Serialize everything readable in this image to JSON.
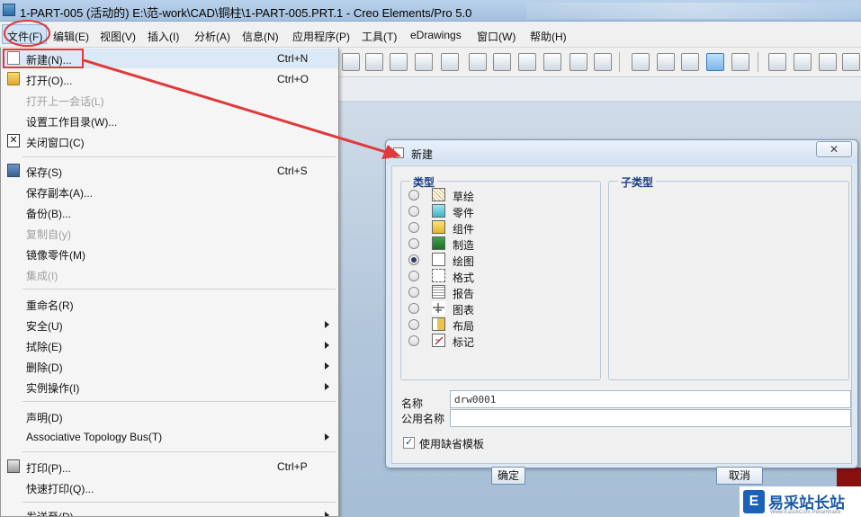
{
  "window": {
    "title": "1-PART-005 (活动的) E:\\范-work\\CAD\\铜柱\\1-PART-005.PRT.1 - Creo Elements/Pro 5.0"
  },
  "menubar": {
    "items": [
      "文件(F)",
      "编辑(E)",
      "视图(V)",
      "插入(I)",
      "分析(A)",
      "信息(N)",
      "应用程序(P)",
      "工具(T)",
      "eDrawings",
      "窗口(W)",
      "帮助(H)"
    ]
  },
  "file_menu": {
    "new": {
      "label": "新建(N)...",
      "shortcut": "Ctrl+N"
    },
    "open": {
      "label": "打开(O)...",
      "shortcut": "Ctrl+O"
    },
    "open_last_session": {
      "label": "打开上一会话(L)"
    },
    "set_working_dir": {
      "label": "设置工作目录(W)..."
    },
    "close_window": {
      "label": "关闭窗口(C)"
    },
    "save": {
      "label": "保存(S)",
      "shortcut": "Ctrl+S"
    },
    "save_copy": {
      "label": "保存副本(A)..."
    },
    "backup": {
      "label": "备份(B)..."
    },
    "copy_from": {
      "label": "复制自(y)"
    },
    "mirror_part": {
      "label": "镜像零件(M)"
    },
    "integrate": {
      "label": "集成(I)"
    },
    "rename": {
      "label": "重命名(R)"
    },
    "security": {
      "label": "安全(U)"
    },
    "erase": {
      "label": "拭除(E)"
    },
    "delete": {
      "label": "删除(D)"
    },
    "instance_ops": {
      "label": "实例操作(I)"
    },
    "declare": {
      "label": "声明(D)"
    },
    "atb": {
      "label": "Associative Topology Bus(T)"
    },
    "print": {
      "label": "打印(P)...",
      "shortcut": "Ctrl+P"
    },
    "quick_print": {
      "label": "快速打印(Q)..."
    },
    "send_to": {
      "label": "发送至(D)"
    }
  },
  "dialog": {
    "title": "新建",
    "close_label": "✕",
    "type_group_title": "类型",
    "subtype_group_title": "子类型",
    "types": [
      {
        "label": "草绘",
        "icon": "sketch-icon",
        "checked": false
      },
      {
        "label": "零件",
        "icon": "part-icon",
        "checked": false
      },
      {
        "label": "组件",
        "icon": "assembly-icon",
        "checked": false
      },
      {
        "label": "制造",
        "icon": "manufacturing-icon",
        "checked": false
      },
      {
        "label": "绘图",
        "icon": "drawing-icon",
        "checked": true
      },
      {
        "label": "格式",
        "icon": "format-icon",
        "checked": false
      },
      {
        "label": "报告",
        "icon": "report-icon",
        "checked": false
      },
      {
        "label": "图表",
        "icon": "diagram-icon",
        "checked": false
      },
      {
        "label": "布局",
        "icon": "layout-icon",
        "checked": false
      },
      {
        "label": "标记",
        "icon": "markup-icon",
        "checked": false
      }
    ],
    "name_label": "名称",
    "name_value": "drw0001",
    "common_name_label": "公用名称",
    "common_name_value": "",
    "use_default_template_label": "使用缺省模板",
    "use_default_template_checked": true,
    "ok_label": "确定",
    "cancel_label": "取消"
  },
  "watermark": {
    "text": "易采站长站",
    "sub": "Www.EasckCom.Pexamnaire"
  },
  "colors": {
    "annotation_red": "#e0393b",
    "group_title_blue": "#1b3f82"
  }
}
